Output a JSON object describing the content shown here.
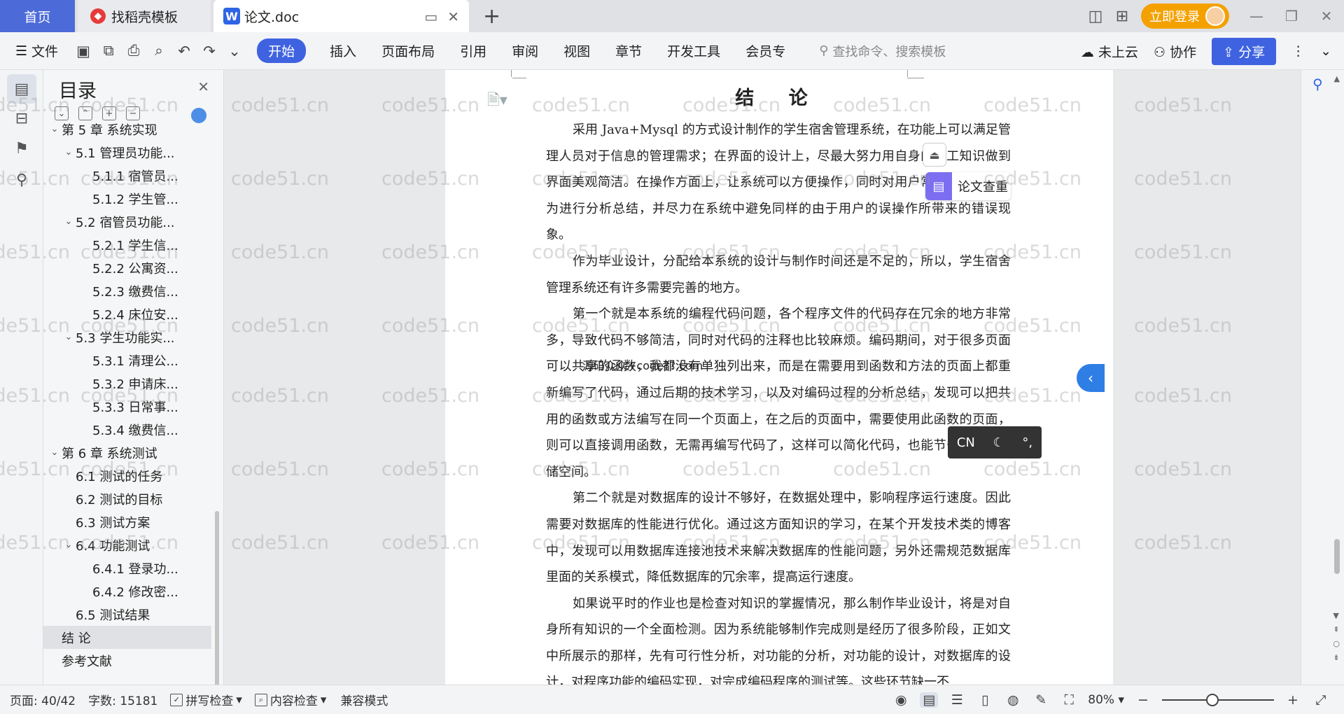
{
  "tabs": {
    "home": "首页",
    "template": "找稻壳模板",
    "document": "论文.doc"
  },
  "title_bar": {
    "login_label": "立即登录"
  },
  "toolbar": {
    "file_label": "文件",
    "ribbon_tabs": [
      "开始",
      "插入",
      "页面布局",
      "引用",
      "审阅",
      "视图",
      "章节",
      "开发工具",
      "会员专"
    ],
    "search_placeholder": "查找命令、搜索模板",
    "cloud_label": "未上云",
    "collab_label": "协作",
    "share_label": "分享"
  },
  "toc": {
    "title": "目录",
    "items": [
      {
        "level": 1,
        "label": "第 5 章  系统实现",
        "expanded": true
      },
      {
        "level": 2,
        "label": "5.1  管理员功能...",
        "expanded": true
      },
      {
        "level": 3,
        "label": "5.1.1  宿管员..."
      },
      {
        "level": 3,
        "label": "5.1.2  学生管..."
      },
      {
        "level": 2,
        "label": "5.2  宿管员功能...",
        "expanded": true
      },
      {
        "level": 3,
        "label": "5.2.1  学生信..."
      },
      {
        "level": 3,
        "label": "5.2.2  公寓资..."
      },
      {
        "level": 3,
        "label": "5.2.3  缴费信..."
      },
      {
        "level": 3,
        "label": "5.2.4  床位安..."
      },
      {
        "level": 2,
        "label": "5.3  学生功能实...",
        "expanded": true
      },
      {
        "level": 3,
        "label": "5.3.1  清理公..."
      },
      {
        "level": 3,
        "label": "5.3.2  申请床..."
      },
      {
        "level": 3,
        "label": "5.3.3  日常事..."
      },
      {
        "level": 3,
        "label": "5.3.4  缴费信..."
      },
      {
        "level": 1,
        "label": "第 6 章  系统测试",
        "expanded": true
      },
      {
        "level": 2,
        "label": "6.1  测试的任务"
      },
      {
        "level": 2,
        "label": "6.2  测试的目标"
      },
      {
        "level": 2,
        "label": "6.3  测试方案"
      },
      {
        "level": 2,
        "label": "6.4  功能测试",
        "expanded": true
      },
      {
        "level": 3,
        "label": "6.4.1  登录功..."
      },
      {
        "level": 3,
        "label": "6.4.2  修改密..."
      },
      {
        "level": 2,
        "label": "6.5  测试结果"
      },
      {
        "level": 1,
        "label": "结  论",
        "selected": true
      },
      {
        "level": 1,
        "label": "参考文献"
      }
    ]
  },
  "document": {
    "heading": "结  论",
    "paragraphs": [
      "采用 Java+Mysql 的方式设计制作的学生宿舍管理系统，在功能上可以满足管理人员对于信息的管理需求；在界面的设计上，尽最大努力用自身的美工知识做到界面美观简洁。在操作方面上，让系统可以方便操作，同时对用户常见的误操作行为进行分析总结，并尽力在系统中避免同样的由于用户的误操作所带来的错误现象。",
      "作为毕业设计，分配给本系统的设计与制作时间还是不足的，所以，学生宿舍管理系统还有许多需要完善的地方。",
      "第一个就是本系统的编程代码问题，各个程序文件的代码存在冗余的地方非常多，导致代码不够简洁，同时对代码的注释也比较麻烦。编码期间，对于很多页面可以共享的函数，我都没有单独列出来，而是在需要用到函数和方法的页面上都重新编写了代码，通过后期的技术学习，以及对编码过程的分析总结，发现可以把共用的函数或方法编写在同一个页面上，在之后的页面中，需要使用此函数的页面，则可以直接调用函数，无需再编写代码了，这样可以简化代码，也能节省时间和存储空间。",
      "第二个就是对数据库的设计不够好，在数据处理中，影响程序运行速度。因此需要对数据库的性能进行优化。通过这方面知识的学习，在某个开发技术类的博客中，发现可以用数据库连接池技术来解决数据库的性能问题，另外还需规范数据库里面的关系模式，降低数据库的冗余率，提高运行速度。",
      "如果说平时的作业也是检查对知识的掌握情况，那么制作毕业设计，将是对自身所有知识的一个全面检测。因为系统能够制作完成则是经历了很多阶段，正如文中所展示的那样，先有可行性分析，对功能的分析，对功能的设计，对数据库的设计，对程序功能的编码实现，对完成编码程序的测试等。这些环节缺一不"
    ],
    "overlay_note": "源码众众+code??.com"
  },
  "side_panel": {
    "paper_check": "论文查重",
    "ime_mode": "CN"
  },
  "watermark": "code51.cn",
  "status_bar": {
    "page": "页面: 40/42",
    "words": "字数: 15181",
    "spellcheck": "拼写检查",
    "content_check": "内容检查",
    "compat_mode": "兼容模式",
    "zoom": "80%",
    "zoom_level": 0.45
  }
}
